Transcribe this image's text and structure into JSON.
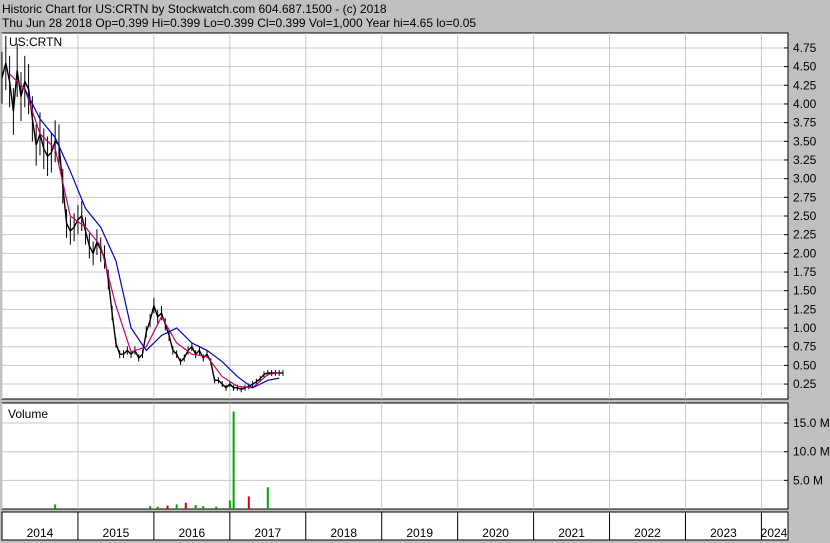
{
  "header": {
    "line1": "Historic Chart for US:CRTN by Stockwatch.com 604.687.1500 - (c) 2018",
    "line2": "Thu Jun 28 2018  Op=0.399  Hi=0.399  Lo=0.399  Cl=0.399  Vol=1,000  Year hi=4.65  lo=0.05"
  },
  "colors": {
    "background": "#c0c0c0",
    "panel": "#ffffff",
    "grid": "#c8c8c8",
    "price": "#000000",
    "ma_short": "#cc0066",
    "ma_long": "#0000cc",
    "volume": "#00aa00",
    "volume_down": "#dd0000"
  },
  "chart_data": [
    {
      "type": "line",
      "symbol": "US:CRTN",
      "x_tick_labels": [
        "2014",
        "2015",
        "2016",
        "2017",
        "2018",
        "2019",
        "2020",
        "2021",
        "2022",
        "2023",
        "2024"
      ],
      "y_tick_labels": [
        "4.75",
        "4.50",
        "4.25",
        "4.00",
        "3.75",
        "3.50",
        "3.25",
        "3.00",
        "2.75",
        "2.50",
        "2.25",
        "2.00",
        "1.75",
        "1.50",
        "1.25",
        "1.00",
        "0.75",
        "0.50",
        "0.25"
      ],
      "xlim": [
        2014.0,
        2024.35
      ],
      "ylim": [
        0.05,
        4.95
      ],
      "grid": true,
      "price": {
        "x": [
          2014.0,
          2014.05,
          2014.1,
          2014.15,
          2014.2,
          2014.25,
          2014.3,
          2014.35,
          2014.4,
          2014.45,
          2014.5,
          2014.55,
          2014.6,
          2014.65,
          2014.7,
          2014.75,
          2014.8,
          2014.85,
          2014.9,
          2014.95,
          2015.0,
          2015.05,
          2015.1,
          2015.15,
          2015.2,
          2015.25,
          2015.3,
          2015.35,
          2015.4,
          2015.45,
          2015.5,
          2015.55,
          2015.6,
          2015.65,
          2015.7,
          2015.75,
          2015.8,
          2015.85,
          2015.9,
          2015.95,
          2016.0,
          2016.05,
          2016.1,
          2016.15,
          2016.2,
          2016.25,
          2016.3,
          2016.35,
          2016.4,
          2016.45,
          2016.5,
          2016.55,
          2016.6,
          2016.65,
          2016.7,
          2016.75,
          2016.8,
          2016.85,
          2016.9,
          2016.95,
          2017.0,
          2017.05,
          2017.1,
          2017.15,
          2017.2,
          2017.25,
          2017.3,
          2017.35,
          2017.4,
          2017.45,
          2017.5,
          2017.55,
          2017.6,
          2017.65,
          2017.7
        ],
        "close": [
          4.35,
          4.55,
          4.3,
          3.9,
          4.45,
          4.1,
          4.3,
          4.2,
          3.8,
          3.45,
          3.6,
          3.4,
          3.3,
          3.35,
          3.5,
          3.45,
          2.9,
          2.4,
          2.3,
          2.35,
          2.45,
          2.5,
          2.3,
          2.1,
          2.0,
          2.15,
          2.05,
          1.95,
          1.65,
          1.2,
          0.8,
          0.65,
          0.65,
          0.7,
          0.65,
          0.7,
          0.6,
          0.65,
          0.95,
          1.1,
          1.3,
          1.15,
          1.2,
          1.05,
          0.9,
          0.7,
          0.65,
          0.55,
          0.6,
          0.7,
          0.75,
          0.65,
          0.7,
          0.6,
          0.65,
          0.55,
          0.3,
          0.3,
          0.25,
          0.2,
          0.25,
          0.2,
          0.2,
          0.18,
          0.2,
          0.22,
          0.25,
          0.28,
          0.32,
          0.38,
          0.4,
          0.4,
          0.4,
          0.4,
          0.4
        ],
        "year_hi": 4.65,
        "year_lo": 0.05
      },
      "ma_short": {
        "x": [
          2014.1,
          2014.3,
          2014.5,
          2014.7,
          2014.9,
          2015.1,
          2015.3,
          2015.5,
          2015.7,
          2015.9,
          2016.1,
          2016.3,
          2016.5,
          2016.7,
          2016.9,
          2017.1,
          2017.3,
          2017.5,
          2017.65
        ],
        "y": [
          4.4,
          4.2,
          3.6,
          3.4,
          2.5,
          2.35,
          2.1,
          1.3,
          0.68,
          0.75,
          1.15,
          0.8,
          0.65,
          0.62,
          0.35,
          0.22,
          0.2,
          0.38,
          0.4
        ]
      },
      "ma_long": {
        "x": [
          2014.3,
          2014.5,
          2014.7,
          2014.9,
          2015.1,
          2015.3,
          2015.5,
          2015.7,
          2015.9,
          2016.1,
          2016.3,
          2016.5,
          2016.7,
          2016.9,
          2017.1,
          2017.3,
          2017.5,
          2017.65
        ],
        "y": [
          4.2,
          3.8,
          3.55,
          3.1,
          2.6,
          2.35,
          1.9,
          1.0,
          0.7,
          0.9,
          1.0,
          0.8,
          0.7,
          0.55,
          0.35,
          0.2,
          0.3,
          0.33
        ]
      }
    },
    {
      "type": "bar",
      "title": "Volume",
      "y_tick_labels": [
        "15.0 M",
        "10.0 M",
        "5.0 M"
      ],
      "ylim": [
        0,
        18.5
      ],
      "units": "M",
      "x": [
        2014.7,
        2015.95,
        2016.05,
        2016.18,
        2016.3,
        2016.42,
        2016.55,
        2016.65,
        2016.82,
        2017.0,
        2017.05,
        2017.25,
        2017.5
      ],
      "values": [
        0.8,
        0.5,
        0.4,
        0.6,
        0.8,
        1.1,
        0.7,
        0.5,
        0.4,
        1.5,
        17.0,
        2.2,
        3.8
      ],
      "down": [
        false,
        false,
        false,
        true,
        false,
        true,
        false,
        false,
        false,
        false,
        false,
        true,
        false
      ]
    }
  ]
}
